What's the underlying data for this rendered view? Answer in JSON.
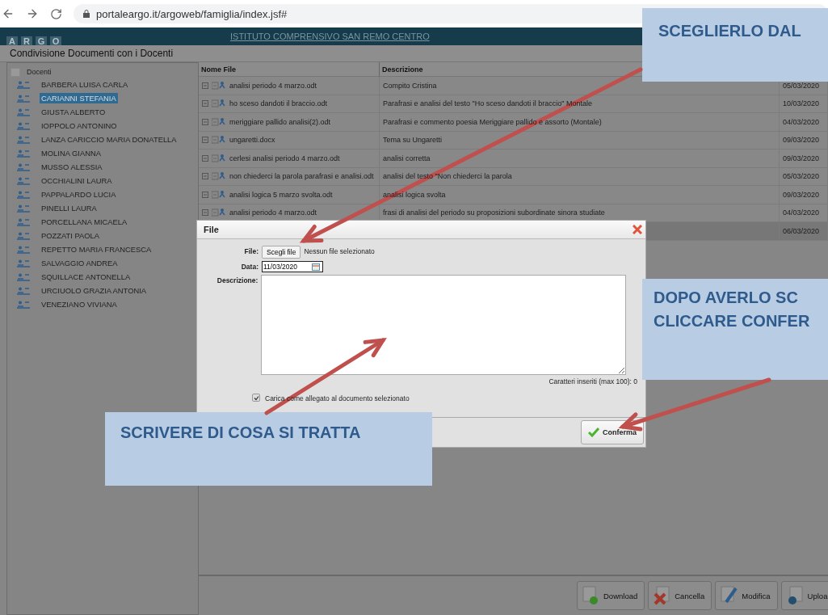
{
  "browser": {
    "url": "portaleargo.it/argoweb/famiglia/index.jsf#"
  },
  "header": {
    "logo_letters": [
      "A",
      "R",
      "G",
      "O"
    ],
    "school": "ISTITUTO COMPRENSIVO SAN REMO CENTRO"
  },
  "panel_title": "Condivisione Documenti con i Docenti",
  "tree": {
    "label": "Docenti",
    "children": [
      {
        "label": "BARBERA LUISA CARLA",
        "selected": false
      },
      {
        "label": "CARIANNI STEFANIA",
        "selected": true
      },
      {
        "label": "GIUSTA ALBERTO",
        "selected": false
      },
      {
        "label": "IOPPOLO ANTONINO",
        "selected": false
      },
      {
        "label": "LANZA CARICCIO MARIA DONATELLA",
        "selected": false
      },
      {
        "label": "MOLINA GIANNA",
        "selected": false
      },
      {
        "label": "MUSSO ALESSIA",
        "selected": false
      },
      {
        "label": "OCCHIALINI LAURA",
        "selected": false
      },
      {
        "label": "PAPPALARDO LUCIA",
        "selected": false
      },
      {
        "label": "PINELLI LAURA",
        "selected": false
      },
      {
        "label": "PORCELLANA MICAELA",
        "selected": false
      },
      {
        "label": "POZZATI PAOLA",
        "selected": false
      },
      {
        "label": "REPETTO MARIA FRANCESCA",
        "selected": false
      },
      {
        "label": "SALVAGGIO ANDREA",
        "selected": false
      },
      {
        "label": "SQUILLACE ANTONELLA",
        "selected": false
      },
      {
        "label": "URCIUOLO GRAZIA ANTONIA",
        "selected": false
      },
      {
        "label": "VENEZIANO VIVIANA",
        "selected": false
      }
    ]
  },
  "table": {
    "columns": [
      "Nome File",
      "Descrizione"
    ],
    "rows": [
      {
        "file": "analisi periodo 4 marzo.odt",
        "description": "Compito Cristina",
        "date": "05/03/2020",
        "selected": false
      },
      {
        "file": "ho sceso dandoti il braccio.odt",
        "description": "Parafrasi e analisi del testo \"Ho sceso dandoti il braccio\" Montale",
        "date": "10/03/2020",
        "selected": false
      },
      {
        "file": "meriggiare pallido analisi(2).odt",
        "description": "Parafrasi e commento poesia Meriggiare pallido e assorto (Montale)",
        "date": "04/03/2020",
        "selected": false
      },
      {
        "file": "ungaretti.docx",
        "description": "Tema su Ungaretti",
        "date": "09/03/2020",
        "selected": false
      },
      {
        "file": "cerlesi analisi periodo 4 marzo.odt",
        "description": "analisi corretta",
        "date": "09/03/2020",
        "selected": false
      },
      {
        "file": "non chiederci la parola parafrasi e analisi.odt",
        "description": "analisi del testo \"Non chiederci la parola",
        "date": "05/03/2020",
        "selected": false
      },
      {
        "file": "analisi logica 5 marzo svolta.odt",
        "description": "analisi logica svolta",
        "date": "09/03/2020",
        "selected": false
      },
      {
        "file": "analisi periodo 4 marzo.odt",
        "description": "frasi di analisi del periodo su proposizioni subordinate sinora studiate",
        "date": "04/03/2020",
        "selected": false
      },
      {
        "date": "06/03/2020",
        "selected": true
      }
    ]
  },
  "toolbar": [
    {
      "kind": "download",
      "label": "Download"
    },
    {
      "kind": "delete",
      "label": "Cancella"
    },
    {
      "kind": "edit",
      "label": "Modifica"
    },
    {
      "kind": "upload",
      "label": "Uploa"
    }
  ],
  "dialog": {
    "title": "File",
    "file_label": "File:",
    "choose_button": "Scegli file",
    "no_file": "Nessun file selezionato",
    "date_label": "Data:",
    "date_value": "11/03/2020",
    "description_label": "Descrizione:",
    "counter": "Caratteri inseriti (max 100): 0",
    "attach": {
      "label": "Carica come allegato al documento selezionato",
      "checked": true
    },
    "confirm": "Conferma"
  },
  "callouts": [
    {
      "lines": [
        "SCEGLIERLO DAL"
      ]
    },
    {
      "lines": [
        "DOPO AVERLO SC",
        "CLICCARE CONFER"
      ]
    },
    {
      "lines": [
        "SCRIVERE DI COSA SI TRATTA"
      ]
    }
  ]
}
